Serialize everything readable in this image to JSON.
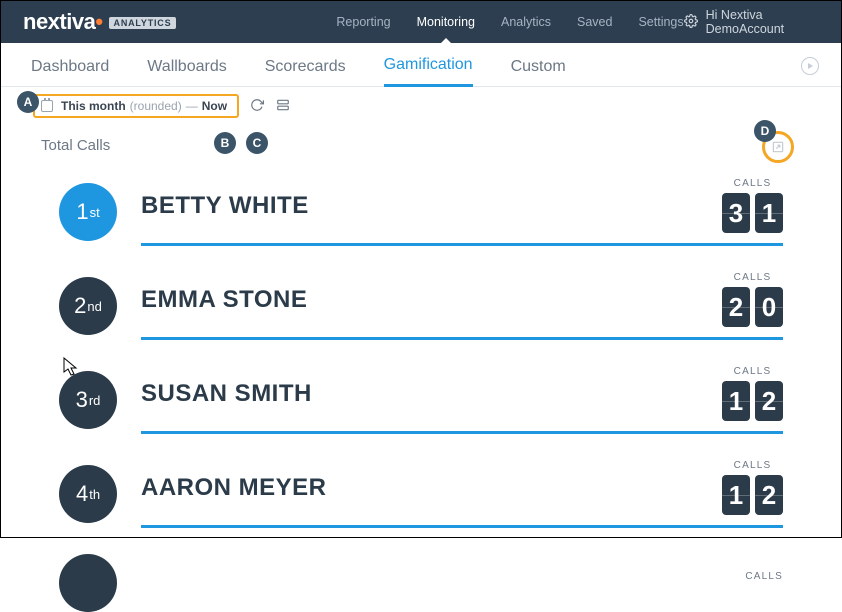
{
  "brand": {
    "name": "nextiva",
    "tag": "ANALYTICS"
  },
  "topnav": {
    "items": [
      "Reporting",
      "Monitoring",
      "Analytics",
      "Saved",
      "Settings"
    ],
    "active_index": 1
  },
  "user_greeting": "Hi Nextiva DemoAccount",
  "subtabs": {
    "items": [
      "Dashboard",
      "Wallboards",
      "Scorecards",
      "Gamification",
      "Custom"
    ],
    "active_index": 3
  },
  "date_range": {
    "from": "This month",
    "qualifier": "(rounded)",
    "separator": "—",
    "to": "Now"
  },
  "section_title": "Total Calls",
  "value_label": "CALLS",
  "leaderboard": [
    {
      "rank": "1",
      "suffix": "st",
      "name": "BETTY WHITE",
      "value": "31",
      "blue": true
    },
    {
      "rank": "2",
      "suffix": "nd",
      "name": "EMMA STONE",
      "value": "20",
      "blue": false
    },
    {
      "rank": "3",
      "suffix": "rd",
      "name": "SUSAN SMITH",
      "value": "12",
      "blue": false
    },
    {
      "rank": "4",
      "suffix": "th",
      "name": "AARON MEYER",
      "value": "12",
      "blue": false
    }
  ],
  "annotations": [
    "A",
    "B",
    "C",
    "D"
  ]
}
